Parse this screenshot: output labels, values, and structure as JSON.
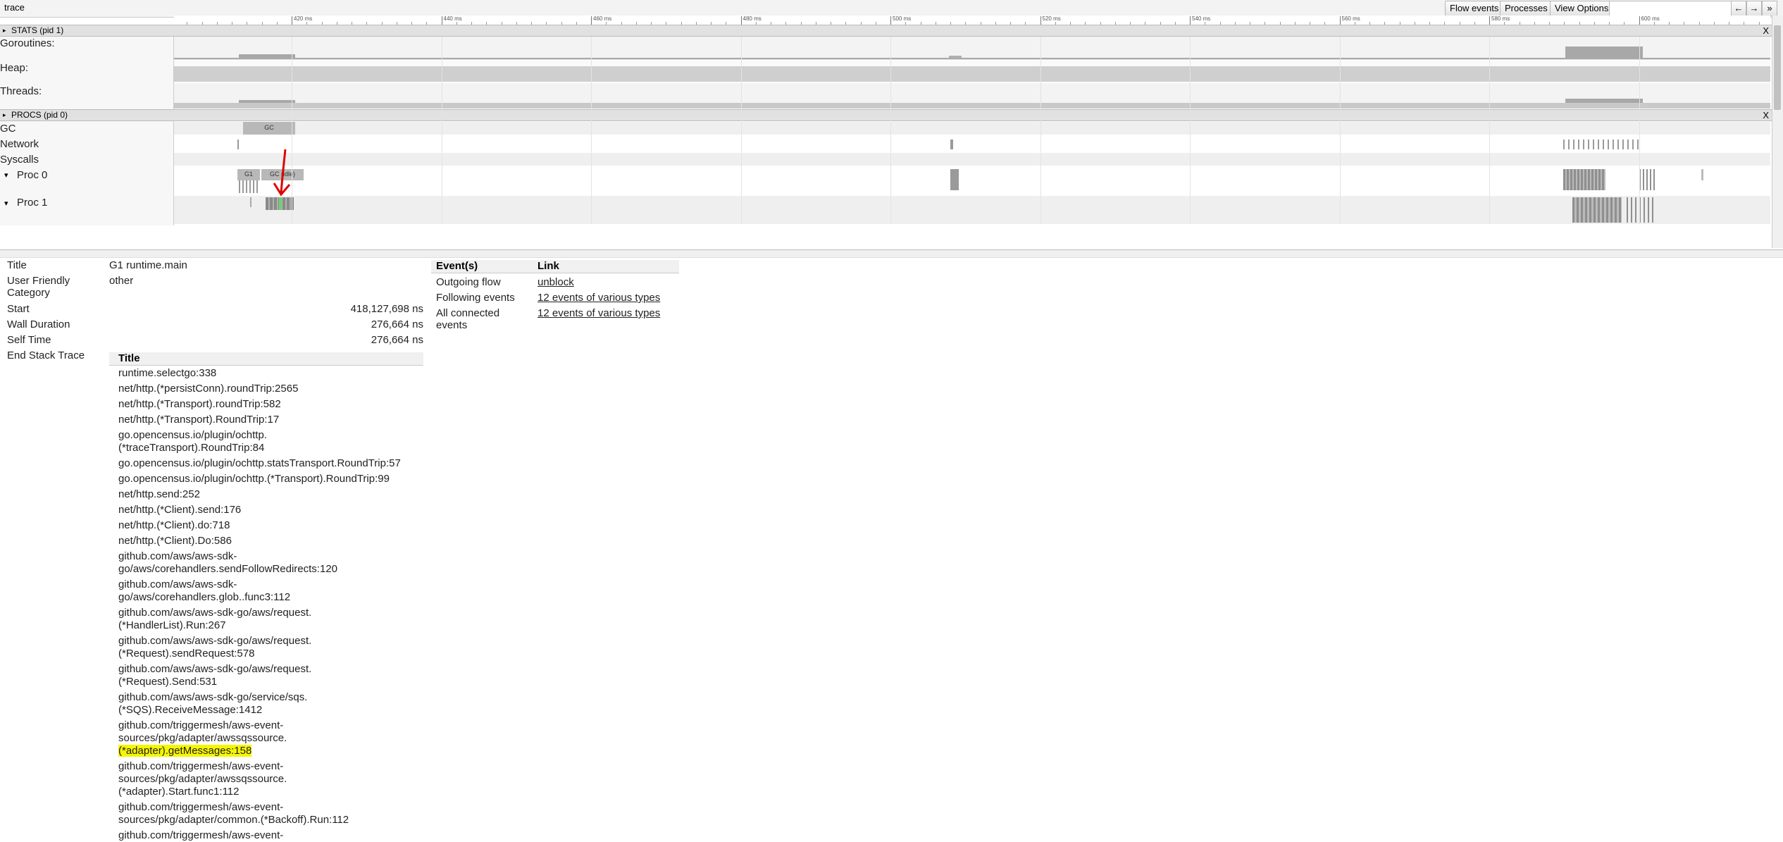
{
  "app": {
    "title": "trace"
  },
  "toolbar": {
    "flow_events": "Flow events",
    "processes": "Processes",
    "view_options": "View Options",
    "search_value": "",
    "nav_prev": "←",
    "nav_next": "→",
    "nav_expand": "»"
  },
  "ruler": {
    "labels": [
      "420 ms",
      "440 ms",
      "460 ms",
      "480 ms",
      "500 ms",
      "520 ms",
      "540 ms",
      "560 ms",
      "580 ms",
      "600 ms"
    ]
  },
  "sections": {
    "stats": {
      "title": "STATS (pid 1)",
      "close": "X",
      "toggle": "▸"
    },
    "procs": {
      "title": "PROCS (pid 0)",
      "close": "X",
      "toggle": "▸"
    }
  },
  "tracks": {
    "goroutines": "Goroutines:",
    "heap": "Heap:",
    "threads": "Threads:",
    "gc": "GC",
    "network": "Network",
    "syscalls": "Syscalls",
    "proc0": "Proc 0",
    "proc1": "Proc 1",
    "toggle": "▾"
  },
  "slices": {
    "gc": "GC",
    "g1": "G1",
    "gc_idle": "GC (idle)"
  },
  "details": {
    "title_label": "Title",
    "title_value": "G1 runtime.main",
    "category_label": "User Friendly Category",
    "category_value": "other",
    "start_label": "Start",
    "start_value": "418,127,698 ns",
    "wall_label": "Wall Duration",
    "wall_value": "276,664 ns",
    "self_label": "Self Time",
    "self_value": "276,664 ns",
    "stack_label": "End Stack Trace",
    "stack_header": "Title",
    "stack": [
      [
        "runtime.selectgo:338"
      ],
      [
        "net/http.(*persistConn).roundTrip:2565"
      ],
      [
        "net/http.(*Transport).roundTrip:582"
      ],
      [
        "net/http.(*Transport).RoundTrip:17"
      ],
      [
        "go.opencensus.io/plugin/ochttp.",
        "(*traceTransport).RoundTrip:84"
      ],
      [
        "go.opencensus.io/plugin/ochttp.statsTransport.RoundTrip:57"
      ],
      [
        "go.opencensus.io/plugin/ochttp.(*Transport).RoundTrip:99"
      ],
      [
        "net/http.send:252"
      ],
      [
        "net/http.(*Client).send:176"
      ],
      [
        "net/http.(*Client).do:718"
      ],
      [
        "net/http.(*Client).Do:586"
      ],
      [
        "github.com/aws/aws-sdk-",
        "go/aws/corehandlers.sendFollowRedirects:120"
      ],
      [
        "github.com/aws/aws-sdk-",
        "go/aws/corehandlers.glob..func3:112"
      ],
      [
        "github.com/aws/aws-sdk-go/aws/request.",
        "(*HandlerList).Run:267"
      ],
      [
        "github.com/aws/aws-sdk-go/aws/request.",
        "(*Request).sendRequest:578"
      ],
      [
        "github.com/aws/aws-sdk-go/aws/request.",
        "(*Request).Send:531"
      ],
      [
        "github.com/aws/aws-sdk-go/service/sqs.",
        "(*SQS).ReceiveMessage:1412"
      ],
      [
        "github.com/triggermesh/aws-event-",
        "sources/pkg/adapter/awssqssource.",
        "(*adapter).getMessages:158"
      ],
      [
        "github.com/triggermesh/aws-event-",
        "sources/pkg/adapter/awssqssource.",
        "(*adapter).Start.func1:112"
      ],
      [
        "github.com/triggermesh/aws-event-",
        "sources/pkg/adapter/common.(*Backoff).Run:112"
      ],
      [
        "github.com/triggermesh/aws-event-"
      ]
    ],
    "highlight_text": "(*adapter).getMessages:158"
  },
  "events": {
    "col_events": "Event(s)",
    "col_link": "Link",
    "rows": [
      {
        "label": "Outgoing flow",
        "link": "unblock"
      },
      {
        "label": "Following events",
        "link": "12 events of various types"
      },
      {
        "label": "All connected events",
        "link": "12 events of various types"
      }
    ]
  },
  "colors": {
    "annotation_arrow": "#e00000",
    "highlight": "#f6f600",
    "slice": "#b8b8b8"
  }
}
